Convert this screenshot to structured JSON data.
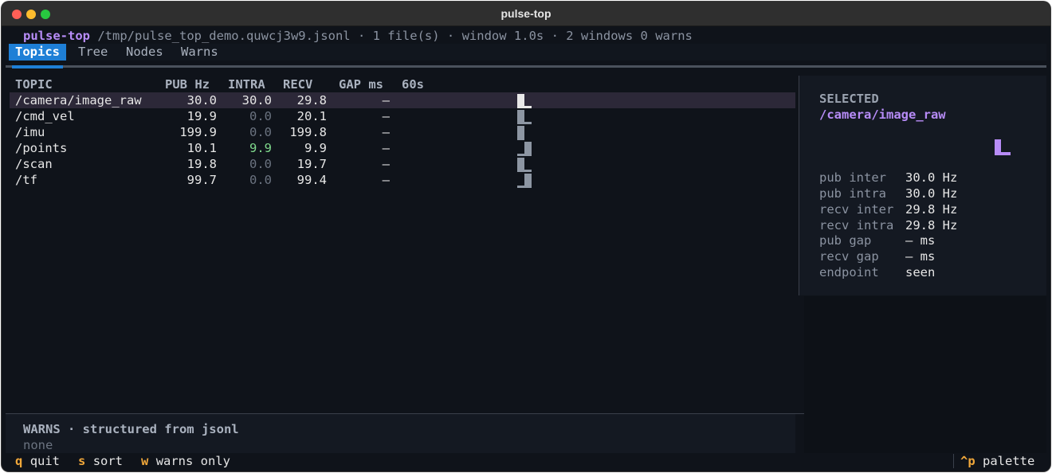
{
  "window": {
    "title": "pulse-top"
  },
  "header": {
    "app": "pulse-top",
    "info": " /tmp/pulse_top_demo.quwcj3w9.jsonl · 1 file(s) · window 1.0s · 2 windows 0 warns"
  },
  "tabs": [
    {
      "label": "Topics",
      "active": true
    },
    {
      "label": "Tree",
      "active": false
    },
    {
      "label": "Nodes",
      "active": false
    },
    {
      "label": "Warns",
      "active": false
    }
  ],
  "table": {
    "columns": {
      "topic": "TOPIC",
      "pub": "PUB Hz",
      "intra": "INTRA",
      "recv": "RECV",
      "gap": "GAP ms",
      "spark": "60s"
    },
    "rows": [
      {
        "topic": "/camera/image_raw",
        "pub": "30.0",
        "intra": "30.0",
        "recv": "29.8",
        "gap": "—",
        "selected": true
      },
      {
        "topic": "/cmd_vel",
        "pub": "19.9",
        "intra": "0.0",
        "recv": "20.1",
        "gap": "—",
        "selected": false
      },
      {
        "topic": "/imu",
        "pub": "199.9",
        "intra": "0.0",
        "recv": "199.8",
        "gap": "—",
        "selected": false
      },
      {
        "topic": "/points",
        "pub": "10.1",
        "intra": "9.9",
        "recv": "9.9",
        "gap": "—",
        "selected": false
      },
      {
        "topic": "/scan",
        "pub": "19.8",
        "intra": "0.0",
        "recv": "19.7",
        "gap": "—",
        "selected": false
      },
      {
        "topic": "/tf",
        "pub": "99.7",
        "intra": "0.0",
        "recv": "99.4",
        "gap": "—",
        "selected": false
      }
    ]
  },
  "selected": {
    "title": "SELECTED",
    "topic": "/camera/image_raw",
    "stats": [
      {
        "label": "pub inter",
        "value": "30.0 Hz"
      },
      {
        "label": "pub intra",
        "value": "30.0 Hz"
      },
      {
        "label": "recv inter",
        "value": "29.8 Hz"
      },
      {
        "label": "recv intra",
        "value": "29.8 Hz"
      },
      {
        "label": "pub gap",
        "value": "— ms"
      },
      {
        "label": "recv gap",
        "value": "— ms"
      },
      {
        "label": "endpoint",
        "value": "seen"
      }
    ]
  },
  "warns": {
    "title": "WARNS · structured from jsonl",
    "body": "none"
  },
  "footer": {
    "items": [
      {
        "key": "q",
        "label": "quit"
      },
      {
        "key": "s",
        "label": "sort"
      },
      {
        "key": "w",
        "label": "warns only"
      }
    ],
    "palette": {
      "key": "^p",
      "label": "palette"
    }
  },
  "colors": {
    "accent": "#1e7fd6",
    "app": "#b78cf7",
    "key": "#f0a73a",
    "selected_row": "#2c2838"
  }
}
